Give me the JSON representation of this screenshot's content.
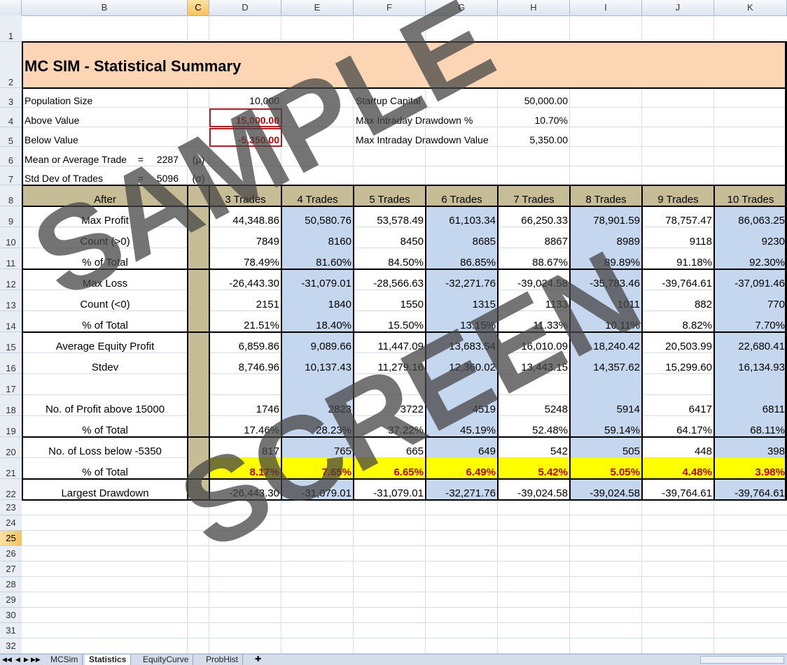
{
  "columns": [
    "",
    "B",
    "C",
    "D",
    "E",
    "F",
    "G",
    "H",
    "I",
    "J",
    "K"
  ],
  "selected_column": "C",
  "selected_row": "25",
  "row_numbers": [
    "1",
    "2",
    "3",
    "4",
    "5",
    "6",
    "7",
    "8",
    "9",
    "10",
    "11",
    "12",
    "13",
    "14",
    "15",
    "16",
    "17",
    "18",
    "19",
    "20",
    "21",
    "22",
    "23",
    "24",
    "25",
    "26",
    "27",
    "28",
    "29",
    "30",
    "31",
    "32"
  ],
  "title": "MC SIM - Statistical Summary",
  "params": {
    "population_size_label": "Population Size",
    "population_size": "10,000",
    "above_value_label": "Above Value",
    "above_value": "15,000.00",
    "below_value_label": "Below Value",
    "below_value": "-5,350.00",
    "startup_capital_label": "Startup Capital",
    "startup_capital": "50,000.00",
    "max_dd_pct_label": "Max Intraday Drawdown %",
    "max_dd_pct": "10.70%",
    "max_dd_val_label": "Max Intraday Drawdown Value",
    "max_dd_val": "5,350.00",
    "mean_label": "Mean or Average Trade",
    "mean_eq": "=",
    "mean": "2287",
    "mean_sym": "(μ)",
    "std_label": "Std Dev of Trades",
    "std_eq": "=",
    "std": "5096",
    "std_sym": "(σ)"
  },
  "table": {
    "header_label": "After",
    "headers": [
      "3 Trades",
      "4 Trades",
      "5 Trades",
      "6 Trades",
      "7 Trades",
      "8 Trades",
      "9 Trades",
      "10 Trades"
    ],
    "rows": [
      {
        "label": "Max Profit",
        "values": [
          "44,348.86",
          "50,580.76",
          "53,578.49",
          "61,103.34",
          "66,250.33",
          "78,901.59",
          "78,757.47",
          "86,063.25"
        ]
      },
      {
        "label": "Count (>0)",
        "values": [
          "7849",
          "8160",
          "8450",
          "8685",
          "8867",
          "8989",
          "9118",
          "9230"
        ]
      },
      {
        "label": "% of Total",
        "values": [
          "78.49%",
          "81.60%",
          "84.50%",
          "86.85%",
          "88.67%",
          "89.89%",
          "91.18%",
          "92.30%"
        ]
      },
      {
        "label": "Max Loss",
        "values": [
          "-26,443.30",
          "-31,079.01",
          "-28,566.63",
          "-32,271.76",
          "-39,024.58",
          "-35,783.46",
          "-39,764.61",
          "-37,091.46"
        ]
      },
      {
        "label": "Count (<0)",
        "values": [
          "2151",
          "1840",
          "1550",
          "1315",
          "1133",
          "1011",
          "882",
          "770"
        ]
      },
      {
        "label": "% of Total",
        "values": [
          "21.51%",
          "18.40%",
          "15.50%",
          "13.15%",
          "11.33%",
          "10.11%",
          "8.82%",
          "7.70%"
        ]
      },
      {
        "label": "Average Equity Profit",
        "values": [
          "6,859.86",
          "9,089.66",
          "11,447.09",
          "13,683.54",
          "16,010.09",
          "18,240.42",
          "20,503.99",
          "22,680.41"
        ]
      },
      {
        "label": "Stdev",
        "values": [
          "8,746.96",
          "10,137.43",
          "11,279.16",
          "12,360.02",
          "13,443.15",
          "14,357.62",
          "15,299.60",
          "16,134.93"
        ]
      },
      {
        "label": "",
        "values": [
          "",
          "",
          "",
          "",
          "",
          "",
          "",
          ""
        ]
      },
      {
        "label": "No. of Profit  above 15000",
        "values": [
          "1746",
          "2823",
          "3722",
          "4519",
          "5248",
          "5914",
          "6417",
          "6811"
        ]
      },
      {
        "label": "% of Total",
        "values": [
          "17.46%",
          "28.23%",
          "37.22%",
          "45.19%",
          "52.48%",
          "59.14%",
          "64.17%",
          "68.11%"
        ]
      },
      {
        "label": "No. of  Loss  below -5350",
        "values": [
          "817",
          "765",
          "665",
          "649",
          "542",
          "505",
          "448",
          "398"
        ]
      },
      {
        "label": "% of Total",
        "values": [
          "8.17%",
          "7.65%",
          "6.65%",
          "6.49%",
          "5.42%",
          "5.05%",
          "4.48%",
          "3.98%"
        ]
      },
      {
        "label": "Largest Drawdown",
        "values": [
          "-26,443.30",
          "-31,079.01",
          "-31,079.01",
          "-32,271.76",
          "-39,024.58",
          "-39,024.58",
          "-39,764.61",
          "-39,764.61"
        ]
      }
    ]
  },
  "sheet_tabs": [
    "MCSim",
    "Statistics",
    "EquityCurve",
    "ProbHist"
  ],
  "active_tab": "Statistics",
  "watermark": [
    "SAMPLE",
    "SCREEN"
  ],
  "colors": {
    "title_fill": "#fcd5b5",
    "header_fill": "#c6bd96",
    "blue_fill": "#c5d7ee",
    "yellow_fill": "#ffff00",
    "red_text": "#c00000"
  }
}
